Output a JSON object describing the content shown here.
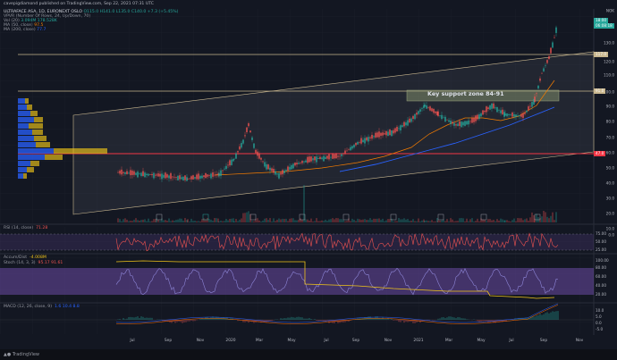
{
  "header": {
    "published_by": "cavepigdiamond published on TradingView.com, Sep 22, 2021 07:31 UTC",
    "symbol_line": "ULTRAFACE ASA, 1D, EURONEXT OSLO",
    "ohlc": "O115.0 H141.0 L135.0 C140.0 +7.3 (+5.45%)",
    "vpvr": "VPVR (Number Of Rows, 24, Up/Down, 70)",
    "vol": "Vol (20)",
    "vol_values": "3.094M  178.528K",
    "ma50": "MA (50, close)",
    "ma50_val": "97.5",
    "ma200": "MA (200, close)",
    "ma200_val": "77.7"
  },
  "annotation": {
    "support_zone": "Key support zone 84-91"
  },
  "price_scale": {
    "currency": "NOK",
    "ticks": [
      "140.0",
      "130.0",
      "120.0",
      "110.0",
      "100.0",
      "90.0",
      "80.0",
      "70.0",
      "60.0",
      "50.0",
      "40.0",
      "30.0",
      "20.0",
      "10.0",
      "0.0"
    ],
    "tags": [
      {
        "label": "18:00",
        "color": "#26a69a"
      },
      {
        "label": "06:08:18",
        "color": "#26a69a"
      },
      {
        "label": "117.0",
        "color": "#c9b78f"
      },
      {
        "label": "91.0",
        "color": "#c9b78f"
      },
      {
        "label": "47.0",
        "color": "#f23645"
      }
    ]
  },
  "rsi": {
    "label": "RSI (14, close)",
    "value": "71.28",
    "ticks": [
      "75.00",
      "50.00",
      "25.00"
    ]
  },
  "stoch": {
    "label": "Accum/Dist",
    "value": "-4.008M",
    "label2": "Stoch (14, 3, 3)",
    "value2": "95.17  91.61",
    "ticks": [
      "100.00",
      "80.00",
      "60.00",
      "40.00",
      "20.00"
    ]
  },
  "macd": {
    "label": "MACD (12, 26, close, 9)",
    "values": "1.6  10.4  8.8",
    "ticks": [
      "10.0",
      "5.0",
      "0.0",
      "-5.0"
    ]
  },
  "xaxis": {
    "labels": [
      "Jul",
      "Sep",
      "Nov",
      "2020",
      "Mar",
      "May",
      "Jul",
      "Sep",
      "Nov",
      "2021",
      "Mar",
      "May",
      "Jul",
      "Sep",
      "Nov"
    ]
  },
  "footer": {
    "brand": "TradingView"
  },
  "colors": {
    "up": "#26a69a",
    "down": "#ef5350",
    "bg": "#131722",
    "level_support": "#c9b78f",
    "level_red": "#f23645",
    "ma50": "#f57c00",
    "ma200": "#2962ff",
    "rsi_line": "#ef5350",
    "accum": "#f0c419",
    "stoch_k": "#8e86d8"
  }
}
